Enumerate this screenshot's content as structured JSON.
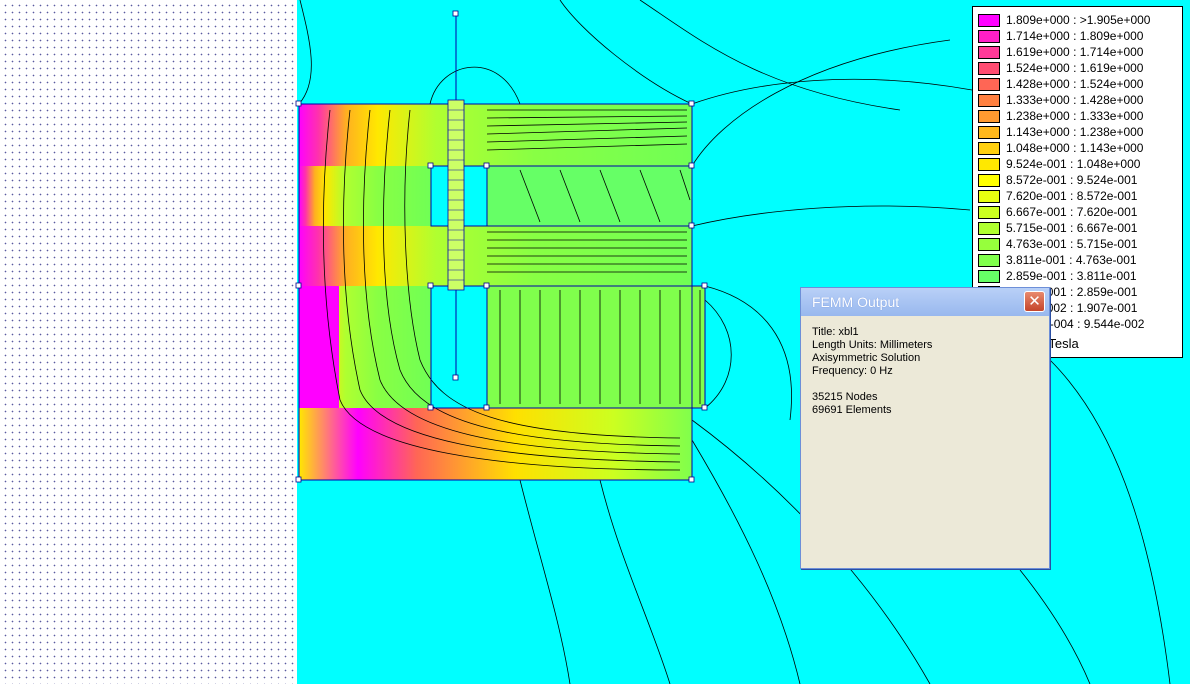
{
  "window": {
    "title": "FEMM Output",
    "close_symbol": "✕",
    "title_line": "Title: xbl1",
    "length_units": "Length Units: Millimeters",
    "solution": "Axisymmetric Solution",
    "frequency": "Frequency: 0 Hz",
    "nodes": "35215 Nodes",
    "elements": "69691 Elements"
  },
  "legend": {
    "unit": "|B|, Tesla",
    "entries": [
      {
        "label": "1.809e+000 : >1.905e+000",
        "color": "#ff00ff"
      },
      {
        "label": "1.714e+000 : 1.809e+000",
        "color": "#ff1fc6"
      },
      {
        "label": "1.619e+000 : 1.714e+000",
        "color": "#ff3a99"
      },
      {
        "label": "1.524e+000 : 1.619e+000",
        "color": "#ff4d72"
      },
      {
        "label": "1.428e+000 : 1.524e+000",
        "color": "#ff6655"
      },
      {
        "label": "1.333e+000 : 1.428e+000",
        "color": "#ff8040"
      },
      {
        "label": "1.238e+000 : 1.333e+000",
        "color": "#ff9a30"
      },
      {
        "label": "1.143e+000 : 1.238e+000",
        "color": "#ffb81c"
      },
      {
        "label": "1.048e+000 : 1.143e+000",
        "color": "#ffd010"
      },
      {
        "label": "9.524e-001 : 1.048e+000",
        "color": "#ffe800"
      },
      {
        "label": "8.572e-001 : 9.524e-001",
        "color": "#ffff00"
      },
      {
        "label": "7.620e-001 : 8.572e-001",
        "color": "#e8ff10"
      },
      {
        "label": "6.667e-001 : 7.620e-001",
        "color": "#ccff20"
      },
      {
        "label": "5.715e-001 : 6.667e-001",
        "color": "#b0ff30"
      },
      {
        "label": "4.763e-001 : 5.715e-001",
        "color": "#96ff3c"
      },
      {
        "label": "3.811e-001 : 4.763e-001",
        "color": "#80ff4c"
      },
      {
        "label": "2.859e-001 : 3.811e-001",
        "color": "#66ff66"
      },
      {
        "label": "1.907e-001 : 2.859e-001",
        "color": "#4cff88"
      },
      {
        "label": "9.544e-002 : 1.907e-001",
        "color": "#33ffaa"
      },
      {
        "label": "<1.142e-004 : 9.544e-002",
        "color": "#00ffff"
      }
    ]
  },
  "colors": {
    "field_background": "#00ffff",
    "geometry_lines": "#0000aa",
    "contour_lines": "#000000"
  }
}
